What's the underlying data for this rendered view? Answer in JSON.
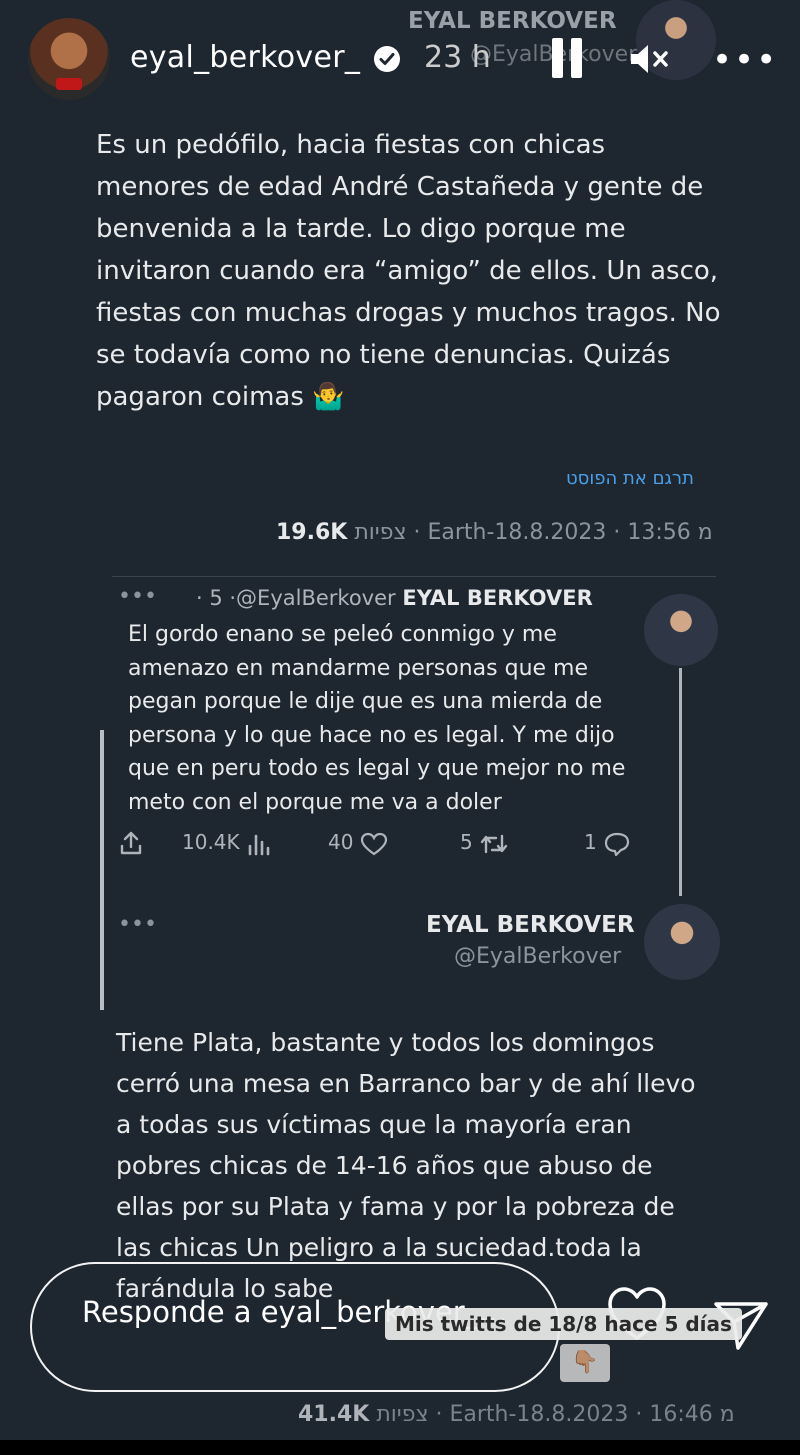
{
  "header": {
    "username": "eyal_berkover_",
    "time": "23 h",
    "watermark_name": "EYAL BERKOVER",
    "watermark_handle": "@EyalBerkover"
  },
  "tweet": {
    "text": "Es un pedófilo, hacia fiestas con chicas menores de edad André Castañeda y gente de benvenida a la tarde. Lo digo porque me invitaron cuando era “amigo” de ellos. Un asco, fiestas con muchas  drogas y muchos tragos. No se todavía como no tiene denuncias. Quizás pagaron coimas 🤷‍♂️",
    "translate_label": "תרגם את הפוסט",
    "views_count": "19.6K",
    "views_label": "צפיות",
    "meta_rest": "· Earth-מ 13:56 · 18.8.2023"
  },
  "quoted": {
    "name": "EYAL BERKOVER",
    "handle_time": "· 5 ·@EyalBerkover",
    "text": "El gordo enano se peleó conmigo y me amenazo en mandarme personas que me pegan porque le dije que es una mierda de persona y lo que hace no es legal. Y me dijo que en peru todo es legal y que mejor no me meto con el porque me va a doler",
    "views": "10.4K",
    "likes": "40",
    "retweets": "5",
    "replies": "1"
  },
  "reply": {
    "name": "EYAL BERKOVER",
    "handle": "@EyalBerkover",
    "text": "Tiene Plata, bastante y todos los domingos cerró una mesa en Barranco bar y de ahí llevo a todas sus víctimas que la mayoría eran pobres chicas de 14-16 años que abuso de ellas por su Plata y fama y por la pobreza de las chicas Un peligro a la suciedad.toda la farándula lo sabe",
    "views_count": "41.4K",
    "views_label": "צפיות",
    "meta_rest": "· Earth-מ 16:46 · 18.8.2023"
  },
  "story": {
    "reply_placeholder": "Responde a eyal_berkover_...",
    "caption": "Mis twitts de 18/8 hace 5 días",
    "caption_emoji": "👇🏽"
  },
  "colors": {
    "background": "#1e2630",
    "link": "#4aa0e8"
  }
}
